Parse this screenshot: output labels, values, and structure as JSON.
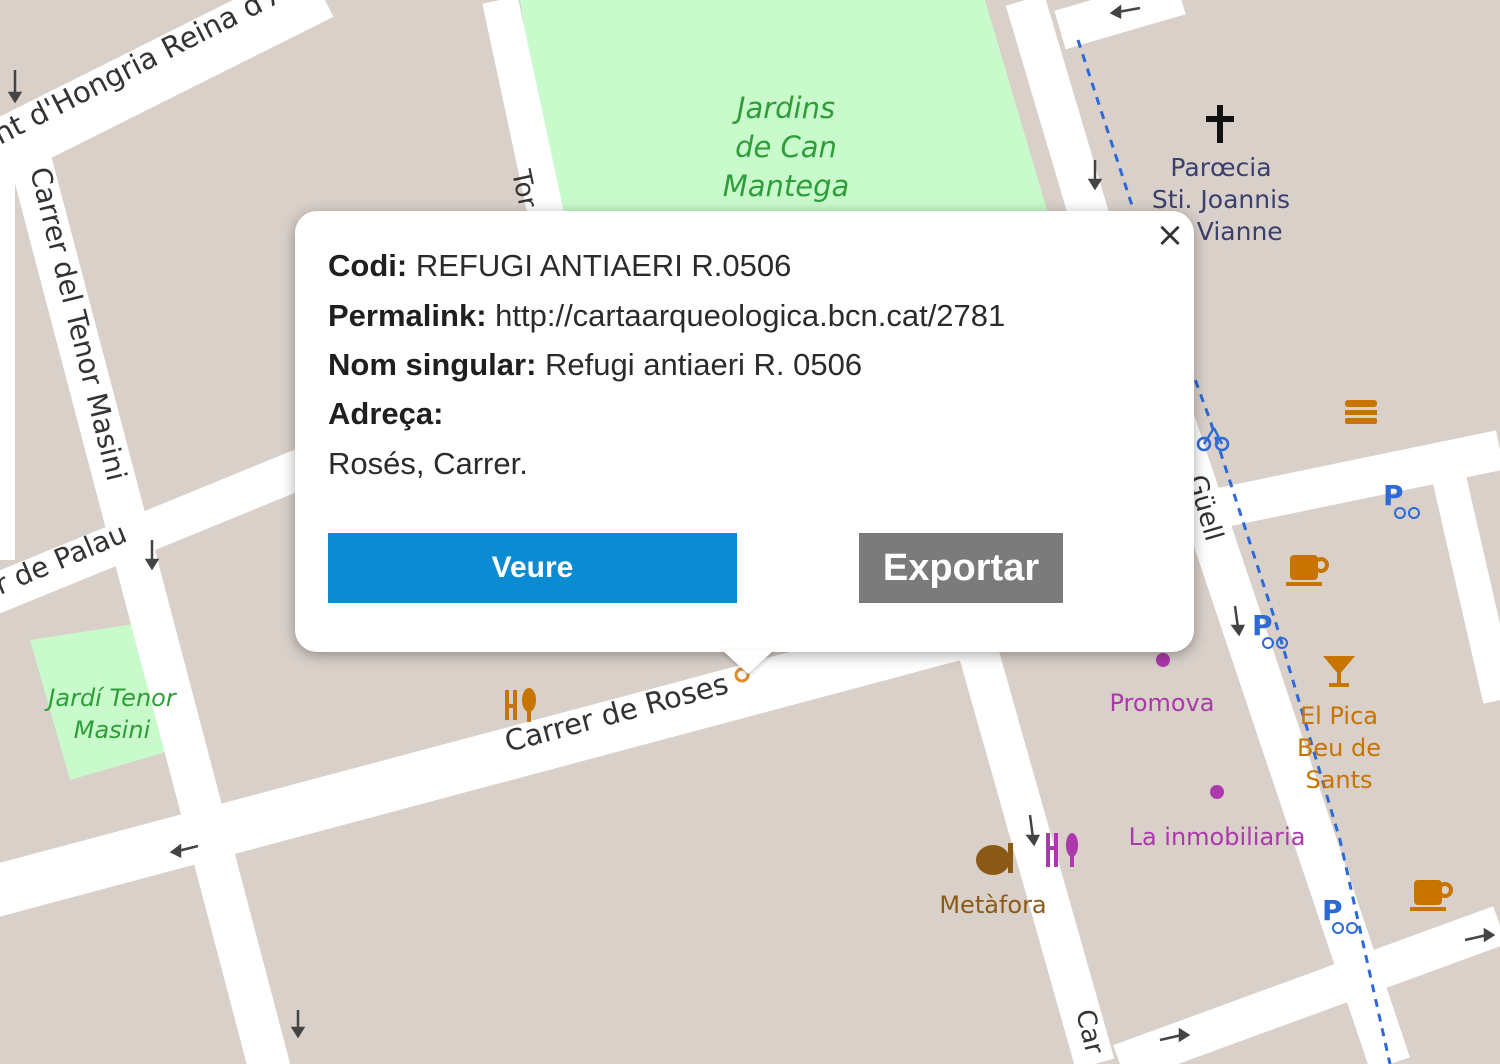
{
  "popup": {
    "close_symbol": "×",
    "fields": [
      {
        "label": "Codi:",
        "value": "REFUGI ANTIAERI R.0506"
      },
      {
        "label": "Permalink:",
        "value": "http://cartaarqueologica.bcn.cat/2781"
      },
      {
        "label": "Nom singular:",
        "value": "Refugi antiaeri R. 0506"
      },
      {
        "label": "Adreça:",
        "value": ""
      }
    ],
    "address_value": "Rosés, Carrer.",
    "view_button": "Veure",
    "export_button": "Exportar",
    "colors": {
      "view": "#0b8bd2",
      "export": "#7b7b7b"
    }
  },
  "map": {
    "street_labels": {
      "hongria": "nt d'Hongria Reina d'Ar",
      "tenor_masini": "Carrer del Tenor Masini",
      "palau": "r de Palau",
      "roses": "Carrer de Roses",
      "tor": "Tor",
      "guell": "Güell",
      "car": "Car"
    },
    "places": {
      "jardins_line1": "Jardins",
      "jardins_line2": "de Can",
      "jardins_line3": "Mantega",
      "jardi_line1": "Jardí Tenor",
      "jardi_line2": "Masini",
      "church_line1": "Parœcia",
      "church_line2": "Sti. Joannis",
      "church_line3": "M. Vianne",
      "promova": "Promova",
      "pica_line1": "El Pica",
      "pica_line2": "Beu de",
      "pica_line3": "Sants",
      "inmobiliaria": "La inmobiliaria",
      "metafora": "Metàfora"
    },
    "icons": [
      "church-cross-icon",
      "fast-food-icon",
      "cafe-icon",
      "bar-icon",
      "restaurant-icon",
      "art-icon",
      "shop-icon",
      "bicycle-parking-icon",
      "oneway-arrow-icon"
    ],
    "colors": {
      "land": "#d9d0c9",
      "road": "#ffffff",
      "park": "#c8facc",
      "park_text": "#2f9e3a",
      "pink": "#ac39ac",
      "amenity": "#c77400",
      "church_text": "#3a3f6e",
      "bike": "#2d6ad6"
    }
  }
}
